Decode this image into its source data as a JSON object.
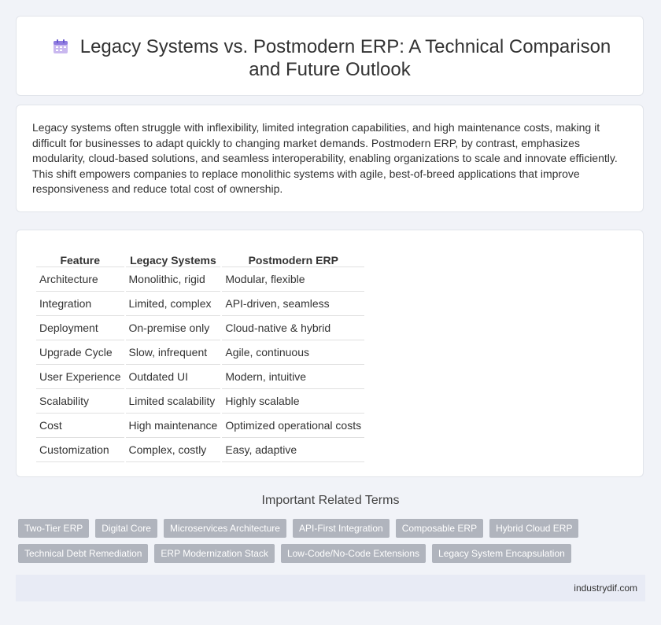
{
  "header": {
    "title_line1": "Legacy Systems vs. Postmodern ERP: A Technical Comparison",
    "title_line2": "and Future Outlook",
    "icon": "calendar-icon"
  },
  "intro": {
    "text": "Legacy systems often struggle with inflexibility, limited integration capabilities, and high maintenance costs, making it difficult for businesses to adapt quickly to changing market demands. Postmodern ERP, by contrast, emphasizes modularity, cloud-based solutions, and seamless interoperability, enabling organizations to scale and innovate efficiently. This shift empowers companies to replace monolithic systems with agile, best-of-breed applications that improve responsiveness and reduce total cost of ownership."
  },
  "table": {
    "headers": [
      "Feature",
      "Legacy Systems",
      "Postmodern ERP"
    ],
    "rows": [
      [
        "Architecture",
        "Monolithic, rigid",
        "Modular, flexible"
      ],
      [
        "Integration",
        "Limited, complex",
        "API-driven, seamless"
      ],
      [
        "Deployment",
        "On-premise only",
        "Cloud-native & hybrid"
      ],
      [
        "Upgrade Cycle",
        "Slow, infrequent",
        "Agile, continuous"
      ],
      [
        "User Experience",
        "Outdated UI",
        "Modern, intuitive"
      ],
      [
        "Scalability",
        "Limited scalability",
        "Highly scalable"
      ],
      [
        "Cost",
        "High maintenance",
        "Optimized operational costs"
      ],
      [
        "Customization",
        "Complex, costly",
        "Easy, adaptive"
      ]
    ]
  },
  "related": {
    "title": "Important Related Terms",
    "tags_row1": [
      "Two-Tier ERP",
      "Digital Core",
      "Microservices Architecture",
      "API-First Integration",
      "Composable ERP",
      "Hybrid Cloud ERP"
    ],
    "tags_row2": [
      "Technical Debt Remediation",
      "ERP Modernization Stack",
      "Low-Code/No-Code Extensions",
      "Legacy System Encapsulation"
    ]
  },
  "footer": {
    "text": "industrydif.com"
  }
}
